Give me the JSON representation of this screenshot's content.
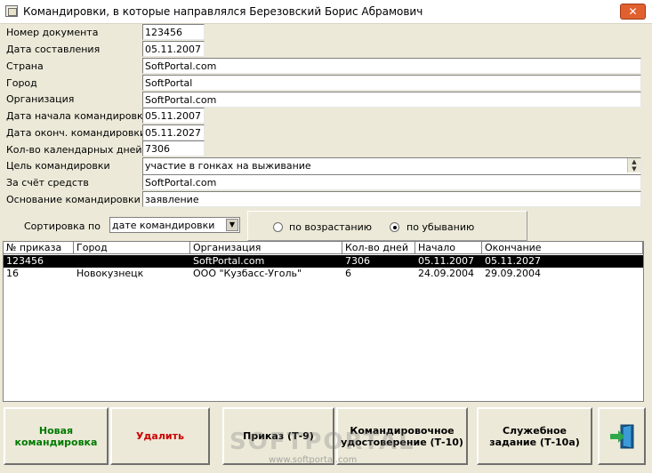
{
  "window": {
    "title": "Командировки, в которые направлялся Березовский Борис Абрамович",
    "close_label": "✕"
  },
  "form": {
    "doc_number": {
      "label": "Номер документа",
      "value": "123456"
    },
    "doc_date": {
      "label": "Дата составления",
      "value": "05.11.2007"
    },
    "country": {
      "label": "Страна",
      "value": "SoftPortal.com"
    },
    "city": {
      "label": "Город",
      "value": "SoftPortal"
    },
    "organization": {
      "label": "Организация",
      "value": "SoftPortal.com"
    },
    "start_date": {
      "label": "Дата начала командировки",
      "value": "05.11.2007"
    },
    "end_date": {
      "label": "Дата оконч. командировки",
      "value": "05.11.2027"
    },
    "days": {
      "label": "Кол-во календарных дней",
      "value": "7306"
    },
    "purpose": {
      "label": "Цель командировки",
      "value": "участие в гонках на выживание"
    },
    "funding": {
      "label": "За счёт средств",
      "value": "SoftPortal.com"
    },
    "basis": {
      "label": "Основание командировки",
      "value": "заявление"
    }
  },
  "sort": {
    "label": "Сортировка по",
    "selected": "дате командировки",
    "asc_label": "по возрастанию",
    "desc_label": "по убыванию",
    "direction": "desc"
  },
  "table": {
    "columns": [
      "№ приказа",
      "Город",
      "Организация",
      "Кол-во дней",
      "Начало",
      "Окончание"
    ],
    "rows": [
      [
        "123456",
        "",
        "SoftPortal.com",
        "7306",
        "05.11.2007",
        "05.11.2027"
      ],
      [
        "16",
        "Новокузнецк",
        "ООО \"Кузбасс-Уголь\"",
        "6",
        "24.09.2004",
        "29.09.2004"
      ]
    ],
    "selected_row": 0
  },
  "buttons": {
    "new": "Новая командировка",
    "delete": "Удалить",
    "order": "Приказ (Т-9)",
    "certificate": "Командировочное удостоверение (Т-10)",
    "task": "Служебное задание (Т-10а)"
  },
  "watermark": {
    "main": "SOFTPORTAL",
    "url": "www.softportal.com"
  },
  "colors": {
    "new_button": "#007a00",
    "delete_button": "#cc0000",
    "selection": "#000000"
  }
}
